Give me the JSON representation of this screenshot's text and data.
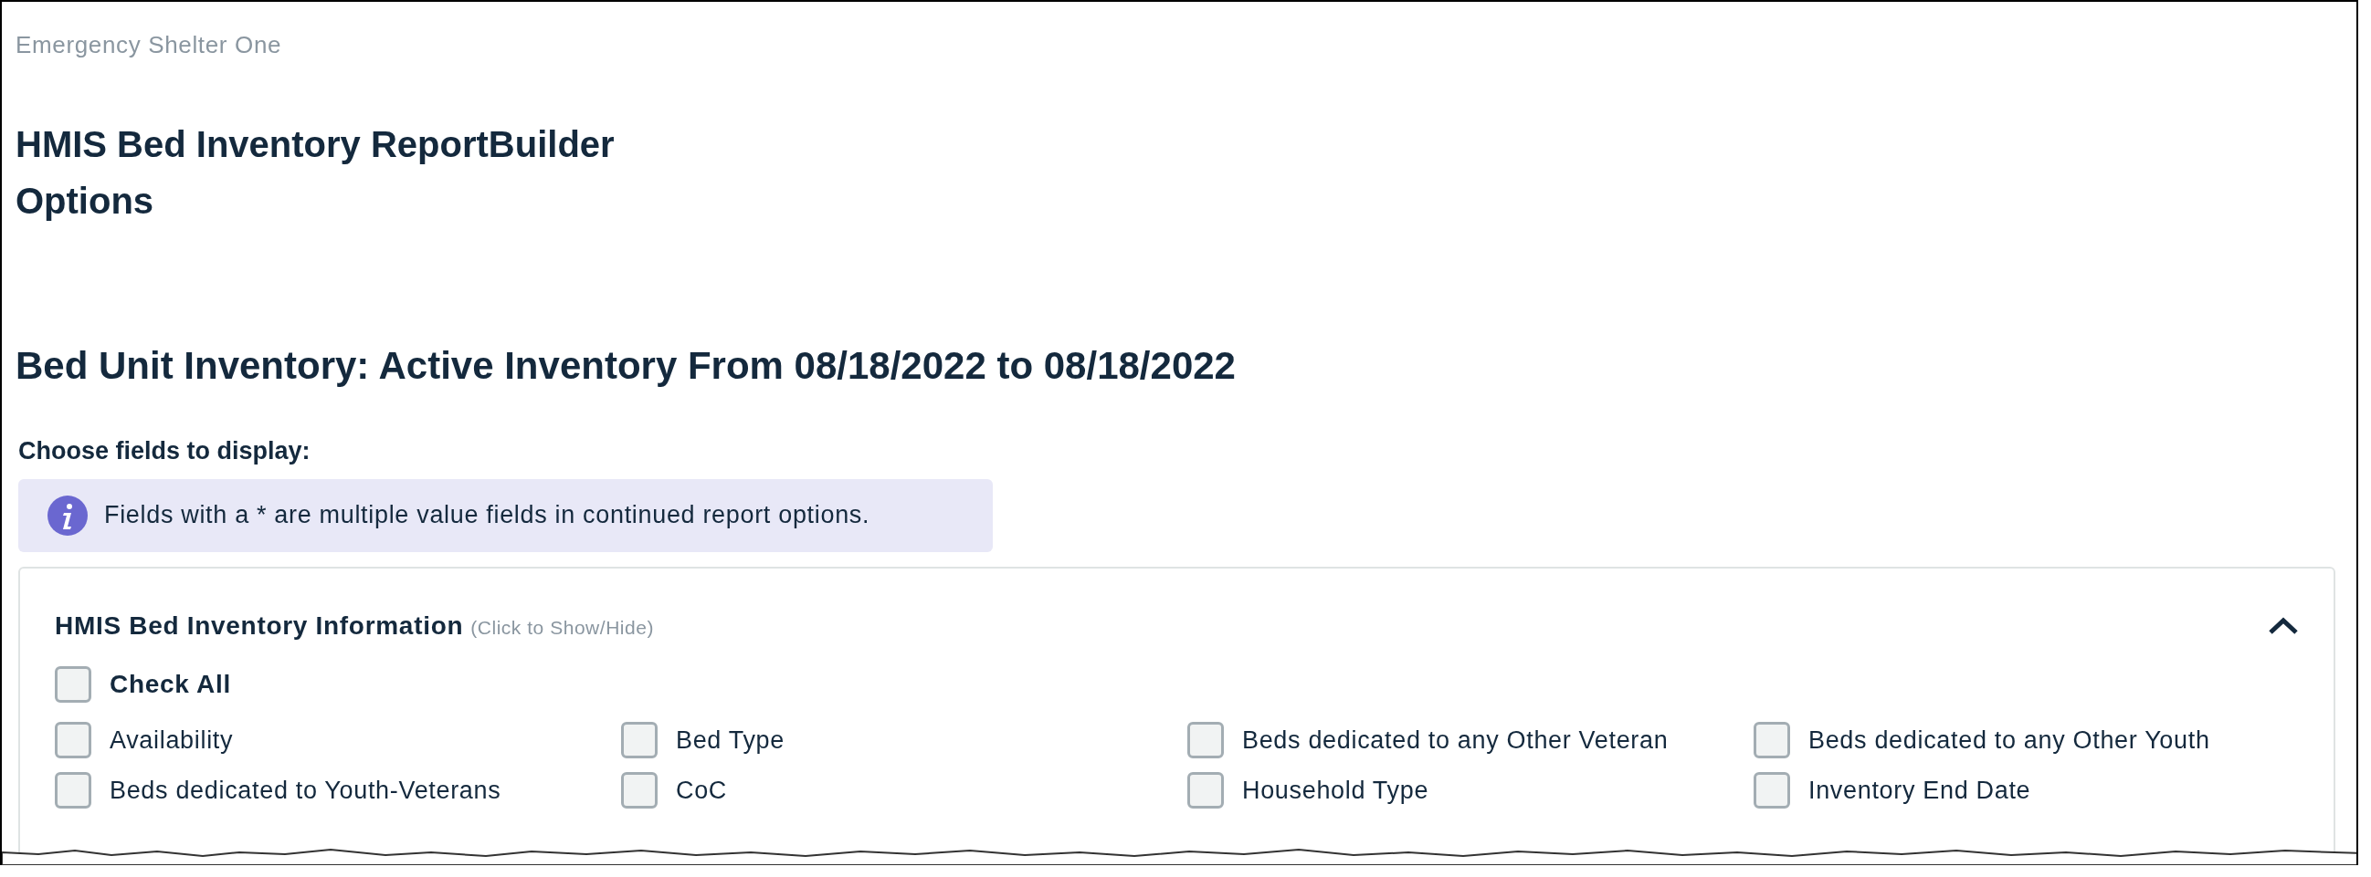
{
  "agency": "Emergency Shelter One",
  "title_lines": [
    "HMIS Bed Inventory ReportBuilder",
    "Options"
  ],
  "section_heading": "Bed Unit Inventory: Active Inventory From 08/18/2022 to 08/18/2022",
  "choose_label": "Choose fields to display:",
  "info_note": "Fields with a * are multiple value fields in continued report options.",
  "panel": {
    "title": "HMIS Bed Inventory Information",
    "hint": "(Click to Show/Hide)",
    "expanded": true,
    "check_all": {
      "label": "Check All",
      "checked": false
    },
    "fields": [
      {
        "label": "Availability",
        "checked": false
      },
      {
        "label": "Bed Type",
        "checked": false
      },
      {
        "label": "Beds dedicated to any Other Veteran",
        "checked": false
      },
      {
        "label": "Beds dedicated to any Other Youth",
        "checked": false
      },
      {
        "label": "Beds dedicated to Youth-Veterans",
        "checked": false
      },
      {
        "label": "CoC",
        "checked": false
      },
      {
        "label": "Household Type",
        "checked": false
      },
      {
        "label": "Inventory End Date",
        "checked": false
      }
    ]
  }
}
